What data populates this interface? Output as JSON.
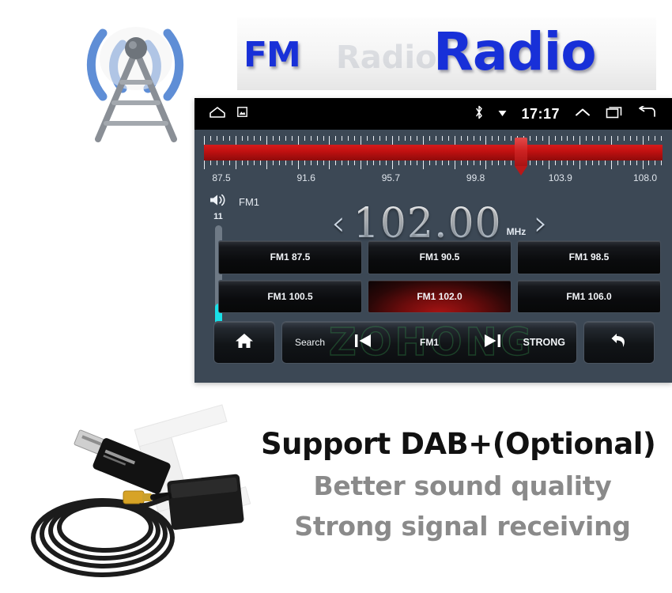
{
  "banner": {
    "fm_word": "FM",
    "radio_word": "Radio",
    "ghost_word": "Radio",
    "tower_icon": "radio-tower-icon"
  },
  "head_unit": {
    "status_bar": {
      "home_icon": "home-outline-icon",
      "screenshot_icon": "screenshot-icon",
      "bluetooth_icon": "bluetooth-icon",
      "dropdown_icon": "caret-down-icon",
      "clock": "17:17",
      "expand_icon": "chevron-up-icon",
      "recents_icon": "recent-apps-icon",
      "back_icon": "back-arrow-icon"
    },
    "tuner": {
      "marker_icon": "tuner-marker-icon",
      "scale_labels": [
        "87.5",
        "91.6",
        "95.7",
        "99.8",
        "103.9",
        "108.0"
      ],
      "scale_min": 87.5,
      "scale_max": 108.0,
      "marker_frequency": 102.0,
      "bar_color": "#c21111"
    },
    "volume": {
      "icon": "speaker-volume-icon",
      "level": "11",
      "level_percent": 35,
      "fill_color": "#19e0e8"
    },
    "band_label": "FM1",
    "frequency": {
      "prev_icon": "chevron-left-icon",
      "value": "102.00",
      "unit": "MHz",
      "next_icon": "chevron-right-icon"
    },
    "presets": [
      {
        "label": "FM1 87.5",
        "active": false
      },
      {
        "label": "FM1 90.5",
        "active": false
      },
      {
        "label": "FM1 98.5",
        "active": false
      },
      {
        "label": "FM1 100.5",
        "active": false
      },
      {
        "label": "FM1 102.0",
        "active": true
      },
      {
        "label": "FM1 106.0",
        "active": false
      }
    ],
    "toolbar": {
      "home_icon": "home-filled-icon",
      "search_label": "Search",
      "prev_track_icon": "previous-track-icon",
      "band_label": "FM1",
      "next_track_icon": "next-track-icon",
      "strong_label": "STRONG",
      "return_icon": "return-arrow-icon",
      "watermark": "ZOHONG"
    }
  },
  "bottom": {
    "dongle_icon": "usb-dab-antenna-icon",
    "title": "Support DAB+(Optional)",
    "line1": "Better sound quality",
    "line2": "Strong signal receiving"
  }
}
